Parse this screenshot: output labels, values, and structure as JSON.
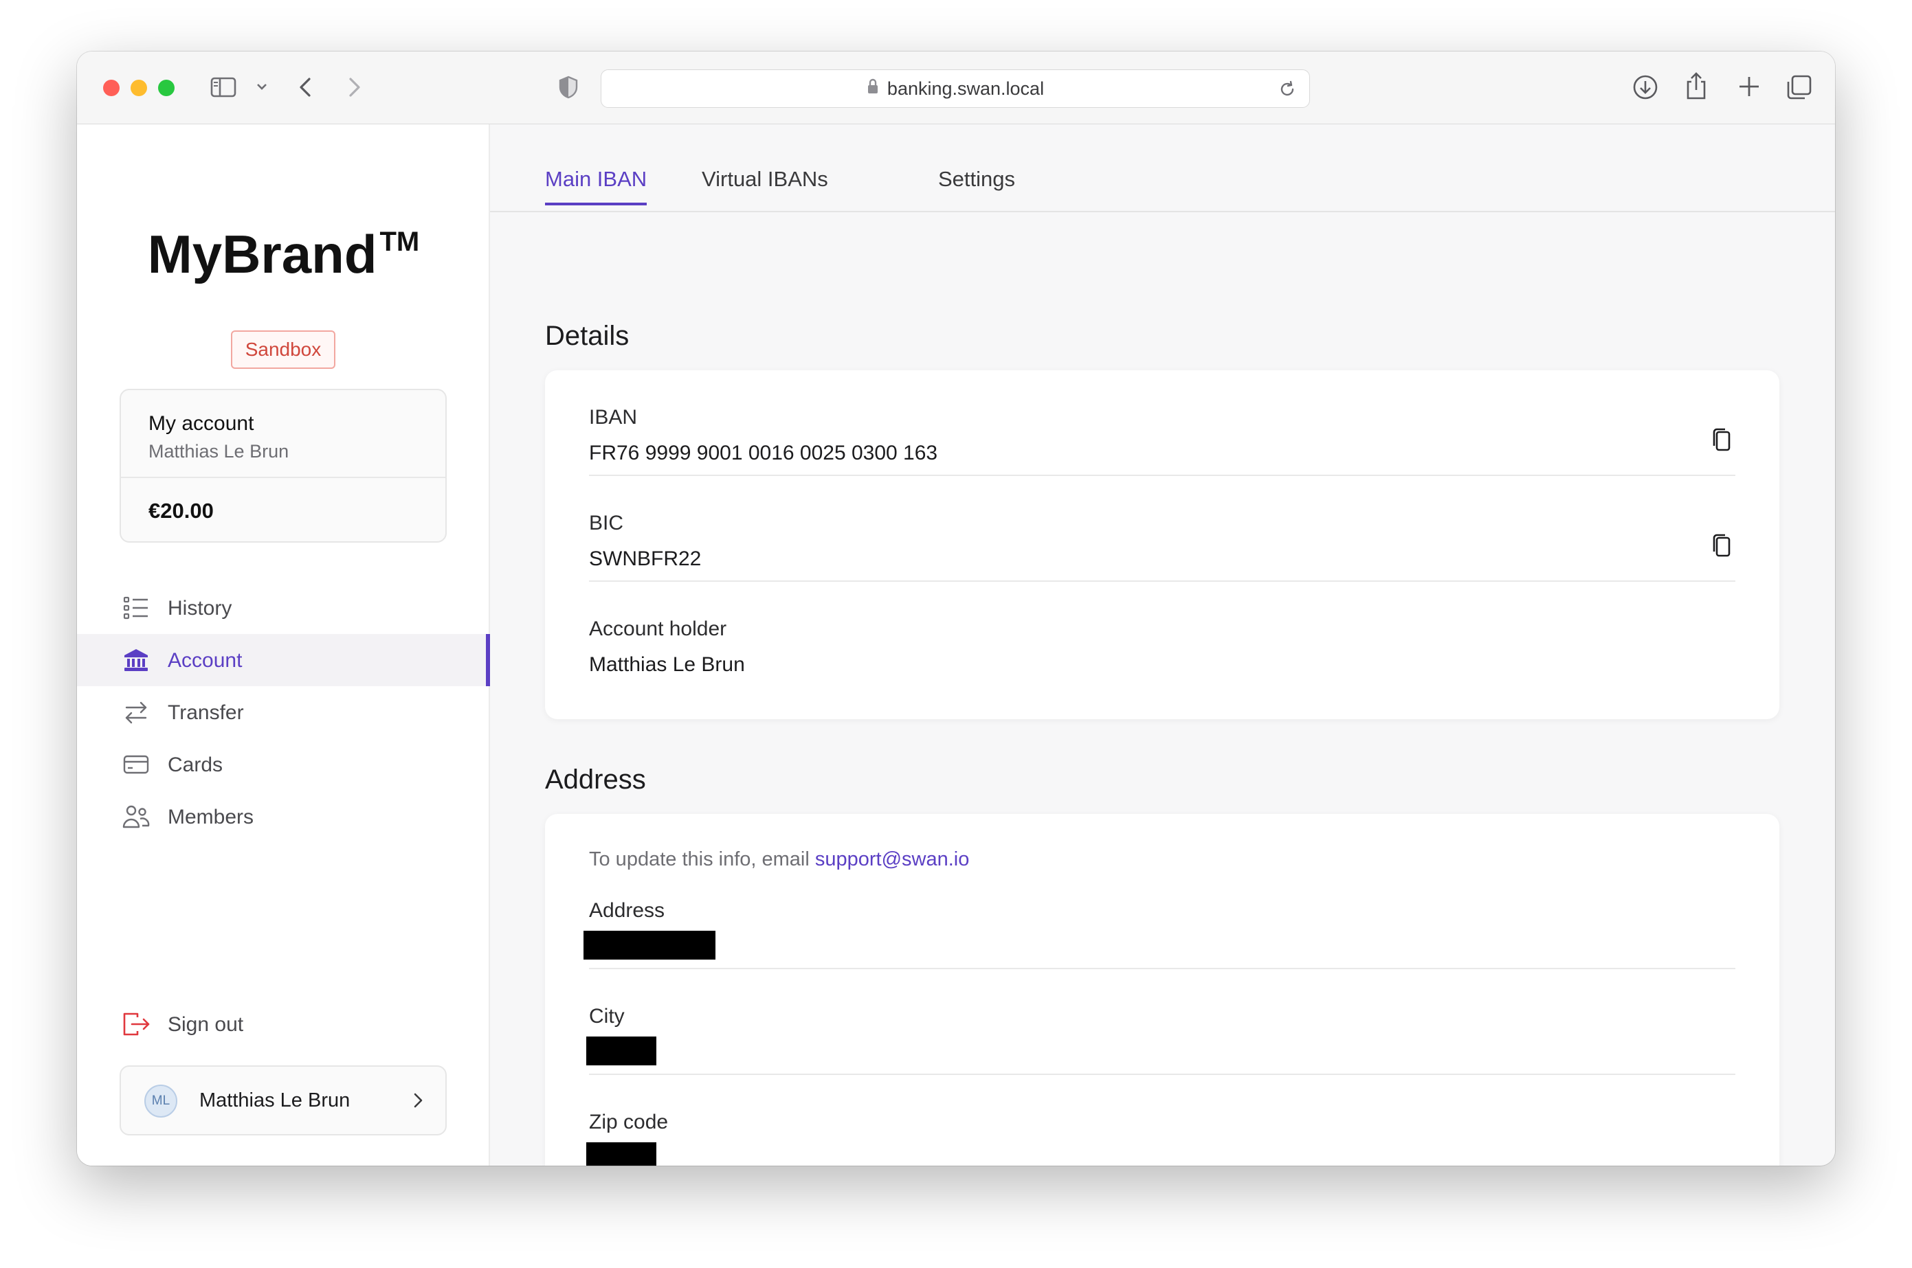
{
  "browser": {
    "url": "banking.swan.local",
    "traffic_colors": {
      "close": "#ff5f57",
      "minimize": "#febc2e",
      "zoom": "#28c840"
    }
  },
  "brand": {
    "name": "MyBrand",
    "mark": "TM",
    "env_badge": "Sandbox",
    "accent": "#5b3fc4",
    "badge_color": "#d0473c"
  },
  "account_card": {
    "title": "My account",
    "owner": "Matthias Le Brun",
    "balance": "€20.00"
  },
  "nav": {
    "items": [
      {
        "label": "History",
        "icon": "list-icon",
        "active": false
      },
      {
        "label": "Account",
        "icon": "bank-icon",
        "active": true
      },
      {
        "label": "Transfer",
        "icon": "transfer-arrows-icon",
        "active": false
      },
      {
        "label": "Cards",
        "icon": "card-icon",
        "active": false
      },
      {
        "label": "Members",
        "icon": "members-icon",
        "active": false
      }
    ],
    "signout": "Sign out"
  },
  "user": {
    "initials": "ML",
    "name": "Matthias Le Brun"
  },
  "tabs": [
    {
      "label": "Main IBAN",
      "active": true
    },
    {
      "label": "Virtual IBANs",
      "active": false
    },
    {
      "label": "Settings",
      "active": false
    }
  ],
  "details": {
    "title": "Details",
    "iban_label": "IBAN",
    "iban_value": "FR76 9999 9001 0016 0025 0300 163",
    "bic_label": "BIC",
    "bic_value": "SWNBFR22",
    "holder_label": "Account holder",
    "holder_value": "Matthias Le Brun"
  },
  "address": {
    "title": "Address",
    "notice_text": "To update this info, email ",
    "notice_email": "support@swan.io",
    "address_label": "Address",
    "city_label": "City",
    "zip_label": "Zip code"
  }
}
